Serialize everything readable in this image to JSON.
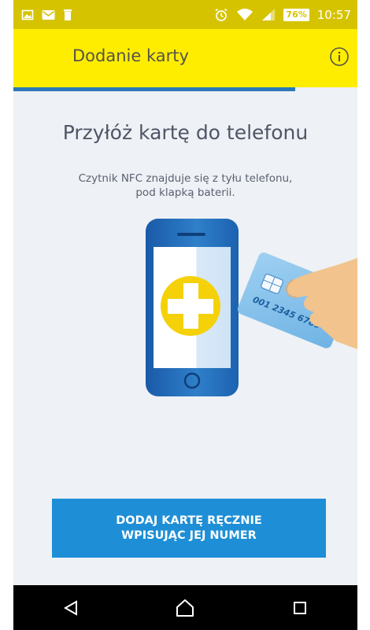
{
  "status_bar": {
    "battery": "76%",
    "time": "10:57",
    "icons": [
      "image-icon",
      "mail-icon",
      "trash-icon",
      "alarm-icon",
      "wifi-icon",
      "signal-icon"
    ]
  },
  "app_bar": {
    "title": "Dodanie karty",
    "info_icon": "info-icon"
  },
  "progress": {
    "fraction": 0.82
  },
  "content": {
    "headline": "Przyłóż kartę do telefonu",
    "subtext_line1": "Czytnik NFC znajduje się z tyłu telefonu,",
    "subtext_line2": "pod klapką baterii.",
    "card_number": "001 2345 6789"
  },
  "manual_button": {
    "line1": "DODAJ KARTĘ RĘCZNIE",
    "line2": "WPISUJĄC JEJ NUMER"
  },
  "nav_bar": {
    "icons": [
      "back-icon",
      "home-icon",
      "recents-icon"
    ]
  },
  "colors": {
    "status_bar": "#d6c300",
    "app_bar": "#ffed00",
    "accent_blue": "#1e8fd6",
    "background": "#eef1f5"
  }
}
